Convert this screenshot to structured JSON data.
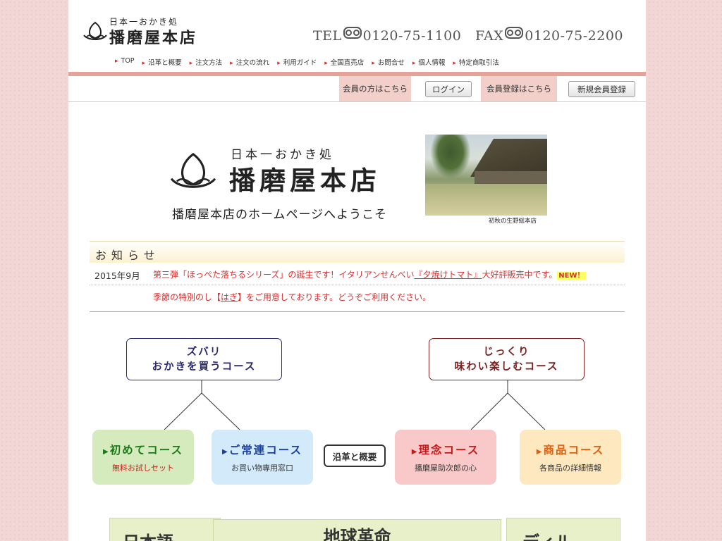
{
  "header": {
    "logo_sub": "日本一おかき処",
    "logo_main": "播磨屋本店",
    "tel_label": "TEL",
    "tel_number": "0120-75-1100",
    "fax_label": "FAX",
    "fax_number": "0120-75-2200",
    "freedial_icon": "freedial-icon"
  },
  "nav": {
    "items": [
      {
        "label": "TOP"
      },
      {
        "label": "沿革と概要"
      },
      {
        "label": "注文方法"
      },
      {
        "label": "注文の流れ"
      },
      {
        "label": "利用ガイド"
      },
      {
        "label": "全国直売店"
      },
      {
        "label": "お問合せ"
      },
      {
        "label": "個人情報"
      },
      {
        "label": "特定商取引法"
      }
    ]
  },
  "member": {
    "member_label": "会員の方はこちら",
    "login_button": "ログイン",
    "register_label": "会員登録はこちら",
    "register_button": "新規会員登録"
  },
  "hero": {
    "sub": "日本一おかき処",
    "main": "播磨屋本店",
    "welcome": "播磨屋本店のホームページへようこそ",
    "photo_caption": "初秋の生野総本店"
  },
  "news": {
    "heading": "お知らせ",
    "items": [
      {
        "date": "2015年9月",
        "text_a": "第三弾「ほっぺた落ちるシリーズ」の誕生です！イタリアンせんべい",
        "text_link": "『夕焼けトマト』",
        "text_b": "大好評販売中です。",
        "badge": "NEW！"
      },
      {
        "date": "",
        "text_a": "季節の特別のし【",
        "text_link": "はぎ",
        "text_b": "】をご用意しております。どうぞご利用ください。"
      }
    ]
  },
  "courses": {
    "group_left": {
      "line1": "ズバリ",
      "line2": "おかきを買うコース"
    },
    "group_right": {
      "line1": "じっくり",
      "line2": "味わい楽しむコース"
    },
    "first": {
      "title": "初めてコース",
      "sub": "無料お試しセット"
    },
    "regular": {
      "title": "ご常連コース",
      "sub": "お買い物専用窓口"
    },
    "history": "沿革と概要",
    "philosophy": {
      "title": "理念コース",
      "sub": "播磨屋助次郎の心"
    },
    "products": {
      "title": "商品コース",
      "sub": "各商品の詳細情報"
    },
    "colors": {
      "green": "#1a7a1a",
      "blue": "#1a3fa0",
      "red": "#c81818",
      "orange": "#e06010",
      "navy": "#2a2a70",
      "maroon": "#7a1f1f"
    }
  },
  "bottom": {
    "left": "日本語",
    "center": "地球革命",
    "right": "ディル"
  }
}
